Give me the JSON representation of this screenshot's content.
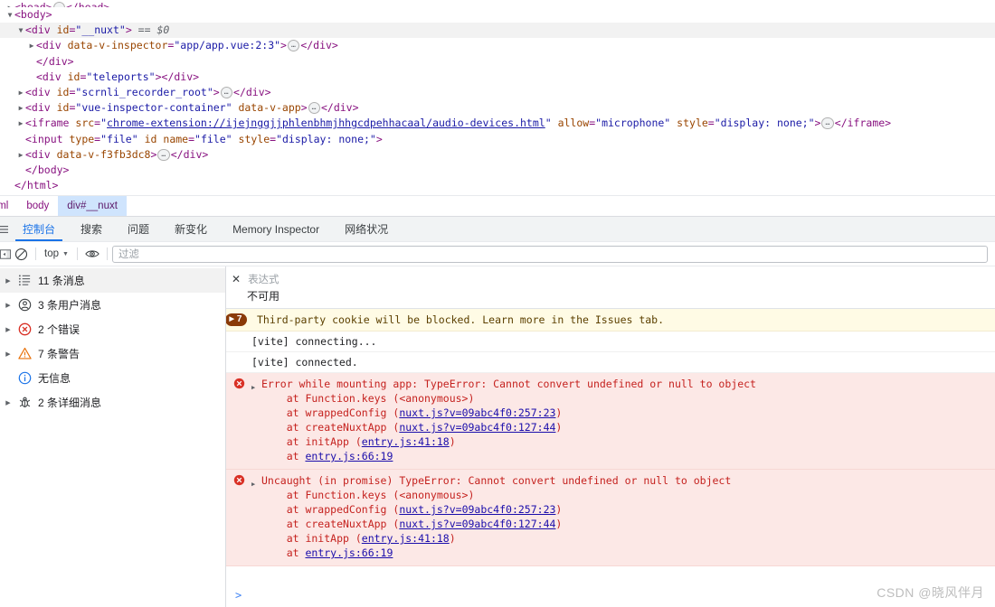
{
  "dom_tree": {
    "lines": [
      {
        "indent": 0,
        "twisty": "closed",
        "clipped": true,
        "selected": false,
        "segments": [
          {
            "t": "tag",
            "v": "<head>"
          },
          {
            "t": "ellipsis"
          },
          {
            "t": "tag",
            "v": "</head>"
          }
        ]
      },
      {
        "indent": 0,
        "twisty": "open",
        "clipped": false,
        "selected": false,
        "segments": [
          {
            "t": "tag",
            "v": "<body>"
          }
        ]
      },
      {
        "indent": 1,
        "twisty": "open",
        "clipped": false,
        "selected": true,
        "segments": [
          {
            "t": "tag",
            "v": "<div "
          },
          {
            "t": "attr-n",
            "v": "id"
          },
          {
            "t": "punct",
            "v": "="
          },
          {
            "t": "attr-v",
            "v": "\"__nuxt\""
          },
          {
            "t": "tag",
            "v": ">"
          },
          {
            "t": "dollar",
            "v": "  == $0"
          }
        ]
      },
      {
        "indent": 2,
        "twisty": "closed",
        "clipped": false,
        "selected": false,
        "segments": [
          {
            "t": "tag",
            "v": "<div "
          },
          {
            "t": "attr-n",
            "v": "data-v-inspector"
          },
          {
            "t": "punct",
            "v": "="
          },
          {
            "t": "attr-v",
            "v": "\"app/app.vue:2:3\""
          },
          {
            "t": "tag",
            "v": ">"
          },
          {
            "t": "ellipsis"
          },
          {
            "t": "tag",
            "v": "</div>"
          }
        ]
      },
      {
        "indent": 2,
        "twisty": "blank",
        "clipped": false,
        "selected": false,
        "segments": [
          {
            "t": "tag",
            "v": "</div>"
          }
        ]
      },
      {
        "indent": 2,
        "twisty": "blank",
        "clipped": false,
        "selected": false,
        "segments": [
          {
            "t": "tag",
            "v": "<div "
          },
          {
            "t": "attr-n",
            "v": "id"
          },
          {
            "t": "punct",
            "v": "="
          },
          {
            "t": "attr-v",
            "v": "\"teleports\""
          },
          {
            "t": "tag",
            "v": "></div>"
          }
        ]
      },
      {
        "indent": 1,
        "twisty": "closed",
        "clipped": false,
        "selected": false,
        "segments": [
          {
            "t": "tag",
            "v": "<div "
          },
          {
            "t": "attr-n",
            "v": "id"
          },
          {
            "t": "punct",
            "v": "="
          },
          {
            "t": "attr-v",
            "v": "\"scrnli_recorder_root\""
          },
          {
            "t": "tag",
            "v": ">"
          },
          {
            "t": "ellipsis"
          },
          {
            "t": "tag",
            "v": "</div>"
          }
        ]
      },
      {
        "indent": 1,
        "twisty": "closed",
        "clipped": false,
        "selected": false,
        "segments": [
          {
            "t": "tag",
            "v": "<div "
          },
          {
            "t": "attr-n",
            "v": "id"
          },
          {
            "t": "punct",
            "v": "="
          },
          {
            "t": "attr-v",
            "v": "\"vue-inspector-container\""
          },
          {
            "t": "tag",
            "v": " "
          },
          {
            "t": "attr-n",
            "v": "data-v-app"
          },
          {
            "t": "tag",
            "v": ">"
          },
          {
            "t": "ellipsis"
          },
          {
            "t": "tag",
            "v": "</div>"
          }
        ]
      },
      {
        "indent": 1,
        "twisty": "closed",
        "clipped": false,
        "selected": false,
        "segments": [
          {
            "t": "tag",
            "v": "<iframe "
          },
          {
            "t": "attr-n",
            "v": "src"
          },
          {
            "t": "punct",
            "v": "="
          },
          {
            "t": "attr-v",
            "v": "\""
          },
          {
            "t": "link",
            "v": "chrome-extension://ijejnggjjphlenbhmjhhgcdpehhacaal/audio-devices.html"
          },
          {
            "t": "attr-v",
            "v": "\""
          },
          {
            "t": "tag",
            "v": " "
          },
          {
            "t": "attr-n",
            "v": "allow"
          },
          {
            "t": "punct",
            "v": "="
          },
          {
            "t": "attr-v",
            "v": "\"microphone\""
          },
          {
            "t": "tag",
            "v": " "
          },
          {
            "t": "attr-n",
            "v": "style"
          },
          {
            "t": "punct",
            "v": "="
          },
          {
            "t": "attr-v",
            "v": "\"display: none;\""
          },
          {
            "t": "tag",
            "v": ">"
          },
          {
            "t": "ellipsis"
          },
          {
            "t": "tag",
            "v": "</iframe>"
          }
        ]
      },
      {
        "indent": 1,
        "twisty": "blank",
        "clipped": false,
        "selected": false,
        "segments": [
          {
            "t": "tag",
            "v": "<input "
          },
          {
            "t": "attr-n",
            "v": "type"
          },
          {
            "t": "punct",
            "v": "="
          },
          {
            "t": "attr-v",
            "v": "\"file\""
          },
          {
            "t": "tag",
            "v": " "
          },
          {
            "t": "attr-n",
            "v": "id"
          },
          {
            "t": "tag",
            "v": " "
          },
          {
            "t": "attr-n",
            "v": "name"
          },
          {
            "t": "punct",
            "v": "="
          },
          {
            "t": "attr-v",
            "v": "\"file\""
          },
          {
            "t": "tag",
            "v": " "
          },
          {
            "t": "attr-n",
            "v": "style"
          },
          {
            "t": "punct",
            "v": "="
          },
          {
            "t": "attr-v",
            "v": "\"display: none;\""
          },
          {
            "t": "tag",
            "v": ">"
          }
        ]
      },
      {
        "indent": 1,
        "twisty": "closed",
        "clipped": false,
        "selected": false,
        "segments": [
          {
            "t": "tag",
            "v": "<div "
          },
          {
            "t": "attr-n",
            "v": "data-v-f3fb3dc8"
          },
          {
            "t": "tag",
            "v": ">"
          },
          {
            "t": "ellipsis"
          },
          {
            "t": "tag",
            "v": "</div>"
          }
        ]
      },
      {
        "indent": 1,
        "twisty": "blank",
        "clipped": false,
        "selected": false,
        "segments": [
          {
            "t": "tag",
            "v": "</body>"
          }
        ]
      },
      {
        "indent": 0,
        "twisty": "blank",
        "clipped": false,
        "selected": false,
        "segments": [
          {
            "t": "tag",
            "v": "</html>"
          }
        ]
      }
    ]
  },
  "breadcrumb": {
    "items": [
      {
        "label": "tml",
        "active": false
      },
      {
        "label": "body",
        "active": false
      },
      {
        "label": "div#__nuxt",
        "active": true
      }
    ]
  },
  "drawer_tabs": {
    "menu_icon": "more-tabs-icon",
    "items": [
      {
        "label": "控制台",
        "active": true
      },
      {
        "label": "搜索",
        "active": false
      },
      {
        "label": "问题",
        "active": false
      },
      {
        "label": "新变化",
        "active": false
      },
      {
        "label": "Memory Inspector",
        "active": false
      },
      {
        "label": "网络状况",
        "active": false
      }
    ]
  },
  "console_toolbar": {
    "sidebar_toggle_icon": "sidebar-panel-icon",
    "clear_icon": "clear-console-icon",
    "context": "top",
    "caret": "▼",
    "eye_icon": "live-expression-eye-icon",
    "filter_placeholder": "过滤",
    "filter_value": ""
  },
  "console_sidebar": {
    "rows": [
      {
        "icon": "message-list-icon",
        "label": "11 条消息",
        "twisty": true,
        "selected": true
      },
      {
        "icon": "user-message-icon",
        "label": "3 条用户消息",
        "twisty": true,
        "selected": false
      },
      {
        "icon": "error-icon",
        "label": "2 个错误",
        "twisty": true,
        "selected": false
      },
      {
        "icon": "warning-icon",
        "label": "7 条警告",
        "twisty": true,
        "selected": false
      },
      {
        "icon": "info-icon",
        "label": "无信息",
        "twisty": false,
        "selected": false
      },
      {
        "icon": "verbose-bug-icon",
        "label": "2 条详细消息",
        "twisty": true,
        "selected": false
      }
    ]
  },
  "live_expression": {
    "close_icon": "close-icon",
    "placeholder": "表达式",
    "value": "不可用"
  },
  "console_messages": [
    {
      "kind": "warnbar",
      "badge_count": "7",
      "badge_caret": "▶",
      "text": "Third-party cookie will be blocked. Learn more in the Issues tab."
    },
    {
      "kind": "plain",
      "text": "[vite] connecting..."
    },
    {
      "kind": "plain",
      "text": "[vite] connected."
    },
    {
      "kind": "error",
      "icon": "error-icon",
      "twisty": "▶",
      "headline": "Error while mounting app: TypeError: Cannot convert undefined or null to object",
      "stack": [
        {
          "prefix": "    at Function.keys (<anonymous>)",
          "link": "",
          "suffix": ""
        },
        {
          "prefix": "    at wrappedConfig (",
          "link": "nuxt.js?v=09abc4f0:257:23",
          "suffix": ")"
        },
        {
          "prefix": "    at createNuxtApp (",
          "link": "nuxt.js?v=09abc4f0:127:44",
          "suffix": ")"
        },
        {
          "prefix": "    at initApp (",
          "link": "entry.js:41:18",
          "suffix": ")"
        },
        {
          "prefix": "    at ",
          "link": "entry.js:66:19",
          "suffix": ""
        }
      ]
    },
    {
      "kind": "error",
      "icon": "error-icon",
      "twisty": "▶",
      "headline": "Uncaught (in promise) TypeError: Cannot convert undefined or null to object",
      "stack": [
        {
          "prefix": "    at Function.keys (<anonymous>)",
          "link": "",
          "suffix": ""
        },
        {
          "prefix": "    at wrappedConfig (",
          "link": "nuxt.js?v=09abc4f0:257:23",
          "suffix": ")"
        },
        {
          "prefix": "    at createNuxtApp (",
          "link": "nuxt.js?v=09abc4f0:127:44",
          "suffix": ")"
        },
        {
          "prefix": "    at initApp (",
          "link": "entry.js:41:18",
          "suffix": ")"
        },
        {
          "prefix": "    at ",
          "link": "entry.js:66:19",
          "suffix": ""
        }
      ]
    }
  ],
  "prompt": {
    "symbol": ">",
    "value": ""
  },
  "watermark": {
    "text": "CSDN @晓风伴月"
  },
  "colors": {
    "accent": "#1a73e8",
    "error_bg": "#fce8e6",
    "error_fg": "#c5221f",
    "warn_bg": "#fffbe5",
    "link": "#1a0dab",
    "tag": "#881280",
    "attr_name": "#994500",
    "attr_value": "#1a1aa6",
    "crumb_active_bg": "#cfe4fd"
  }
}
